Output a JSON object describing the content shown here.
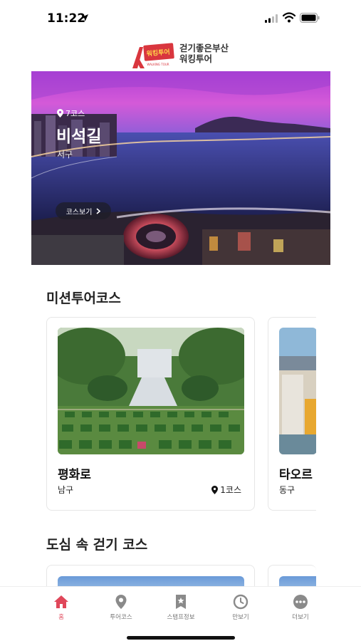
{
  "status_bar": {
    "time": "11:22"
  },
  "header": {
    "logo_line1": "걷기좋은부산",
    "logo_line2": "워킹투어",
    "logo_badge": "워킹투어",
    "logo_sub": "WALKING TOUR"
  },
  "hero": {
    "course_count": "7코스",
    "title": "비석길",
    "region": "서구",
    "button_label": "코스보기"
  },
  "mission_section": {
    "title": "미션투어코스",
    "cards": [
      {
        "title": "평화로",
        "region": "남구",
        "count": "1코스"
      },
      {
        "title": "타오르",
        "region": "동구",
        "count": ""
      }
    ]
  },
  "city_section": {
    "title": "도심 속 걷기 코스"
  },
  "bottom_nav": {
    "items": [
      {
        "label": "홈",
        "icon": "home-icon",
        "active": true
      },
      {
        "label": "투어코스",
        "icon": "map-pin-icon",
        "active": false
      },
      {
        "label": "스탬프정보",
        "icon": "stamp-icon",
        "active": false
      },
      {
        "label": "만보기",
        "icon": "pedometer-icon",
        "active": false
      },
      {
        "label": "더보기",
        "icon": "more-icon",
        "active": false
      }
    ]
  },
  "colors": {
    "accent": "#e0475a",
    "nav_inactive": "#8a8a8a"
  }
}
